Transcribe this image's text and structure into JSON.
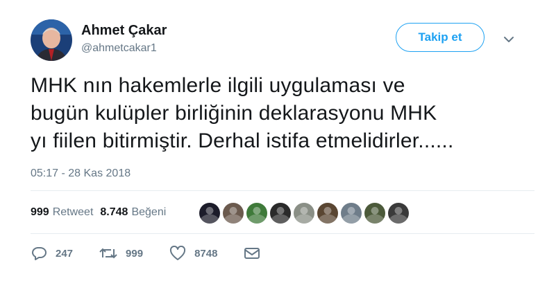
{
  "author": {
    "display_name": "Ahmet Çakar",
    "handle": "@ahmetcakar1",
    "avatar_icon": "user-avatar"
  },
  "follow_button": {
    "label": "Takip et"
  },
  "menu_icon": "chevron-down-icon",
  "tweet": {
    "text_lines": [
      "MHK nın hakemlerle ilgili uygulaması ve",
      "bugün kulüpler birliğinin deklarasyonu MHK",
      "yı fiilen bitirmiştir. Derhal istifa etmelidirler......"
    ],
    "timestamp": "05:17 - 28 Kas 2018"
  },
  "stats": {
    "retweet_count": "999",
    "retweet_label": "Retweet",
    "like_count": "8.748",
    "like_label": "Beğeni"
  },
  "likers": [
    {
      "icon": "liker-avatar-1",
      "color": "#1c1c2a"
    },
    {
      "icon": "liker-avatar-2",
      "color": "#6b5a4e"
    },
    {
      "icon": "liker-avatar-3",
      "color": "#3f7a3a"
    },
    {
      "icon": "liker-avatar-4",
      "color": "#2a2a2a"
    },
    {
      "icon": "liker-avatar-5",
      "color": "#8a8f86"
    },
    {
      "icon": "liker-avatar-6",
      "color": "#5a4632"
    },
    {
      "icon": "liker-avatar-7",
      "color": "#6f7d8a"
    },
    {
      "icon": "liker-avatar-8",
      "color": "#4c5a3a"
    },
    {
      "icon": "liker-avatar-9",
      "color": "#3a3a3a"
    }
  ],
  "actions": {
    "reply_count": "247",
    "retweet_count": "999",
    "like_count": "8748"
  },
  "colors": {
    "accent": "#1da1f2",
    "text_primary": "#14171a",
    "text_secondary": "#657786",
    "divider": "#e6ecf0"
  }
}
